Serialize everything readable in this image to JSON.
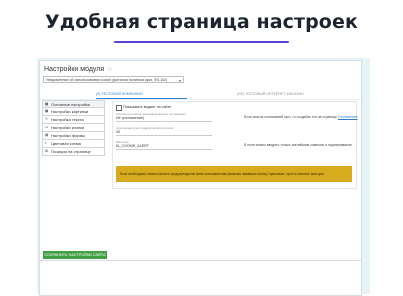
{
  "headline": "Удобная страница настроек",
  "module_title": "Настройки модуля",
  "select_value": "Уведомление об использовании cookie (фаталов политика куки, ФЗ-152)",
  "shop_tabs": [
    "(0) ТЕСТОВОЙ КОМПАНИИ",
    "(SE) ТЕСТОВЫЙ ИНТЕРНЕТ-МАГАЗИН"
  ],
  "sidebar": [
    {
      "icon": "settings-icon",
      "label": "Основные настройки",
      "active": true
    },
    {
      "icon": "image-icon",
      "label": "Настройки картинки"
    },
    {
      "icon": "text-icon",
      "label": "Настройка текста"
    },
    {
      "icon": "button-icon",
      "label": "Настройки кнопки"
    },
    {
      "icon": "form-icon",
      "label": "Настройки формы"
    },
    {
      "icon": "palette-icon",
      "label": "Цветовая схема"
    },
    {
      "icon": "position-icon",
      "label": "Позиция на странице"
    }
  ],
  "form": {
    "checkbox_label": "Показывать виджет на сайте",
    "field1_label": "Ссылка на статью пользовательского соглашения",
    "field1_value": "Не (соглашение)",
    "field1_note": "Если список соглашений пуст, то создайте его на странице",
    "field1_link": "Соглашения",
    "field2_label": "Срок жизни куки (подряд) на Если в днях:",
    "field2_value": "30",
    "field3_label": "Имя куки",
    "field3_value": "IA_COOKIE_ALERT",
    "field3_note": "В поле можно вводить только английские символы и подчеркивание.",
    "warning": "Если необходимо снова показать предупреждение всем пользователям (включая нажавших кнопку 'принимаю', просто смените имя куки."
  },
  "save_button": "СОХРАНИТЬ НАСТРОЙКИ САЙТА"
}
